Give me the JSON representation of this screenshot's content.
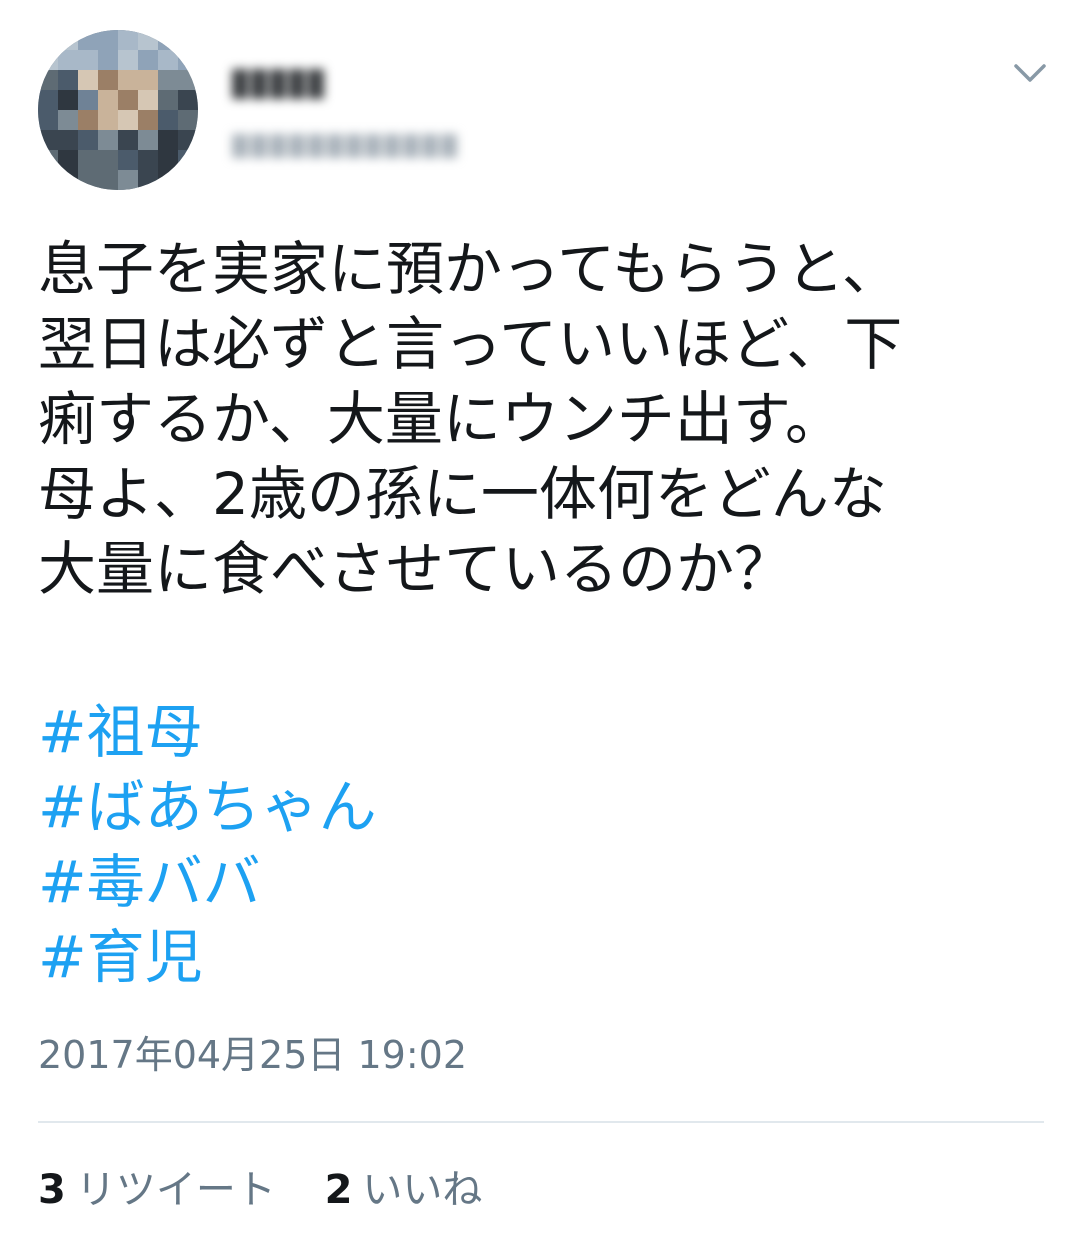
{
  "user": {
    "display_name_hidden": "",
    "handle_hidden": ""
  },
  "tweet": {
    "lines": [
      "息子を実家に預かってもらうと、",
      "翌日は必ずと言っていいほど、下",
      "痢するか、大量にウンチ出す。",
      "母よ、2歳の孫に一体何をどんな",
      "大量に食べさせているのか？"
    ],
    "hashtags": [
      "#祖母",
      "#ばあちゃん",
      "#毒ババ",
      "#育児"
    ],
    "timestamp": "2017年04月25日 19:02"
  },
  "stats": {
    "retweets_count": "3",
    "retweets_label": "リツイート",
    "likes_count": "2",
    "likes_label": "いいね"
  },
  "icons": {
    "menu": "chevron-down-icon"
  },
  "colors": {
    "text": "#14171a",
    "hashtag": "#1da1f2",
    "muted": "#657786",
    "divider": "#e1e8ed"
  }
}
